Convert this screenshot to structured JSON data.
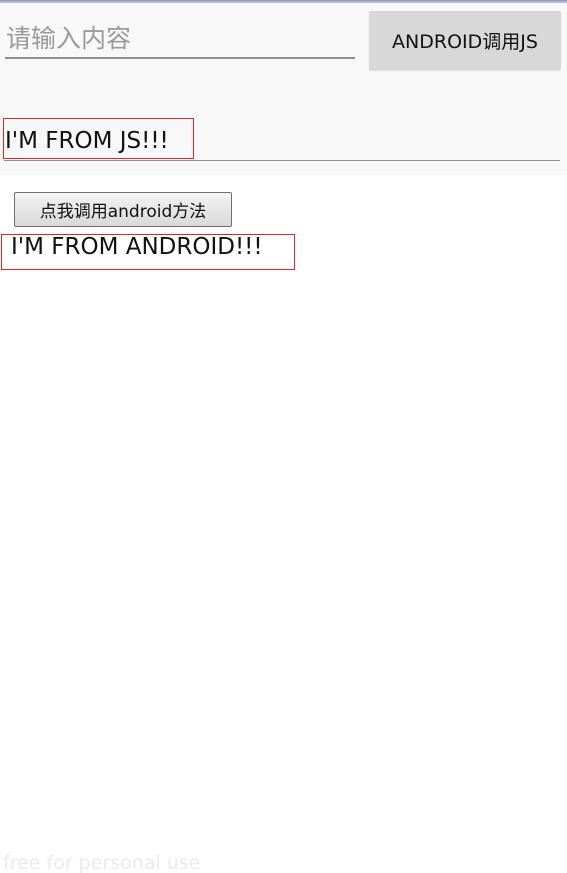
{
  "native": {
    "input_placeholder": "请输入内容",
    "input_value": "",
    "call_js_button_label": "ANDROID调用JS",
    "js_message": "I'M FROM JS!!!"
  },
  "web": {
    "call_android_button_label": "点我调用android方法",
    "android_message": "I'M FROM ANDROID!!!"
  },
  "watermark": "free for personal use",
  "colors": {
    "highlight_border": "#e0242c",
    "native_background": "#f8f8f8",
    "native_button_background": "#d8d8d8",
    "underline": "#8f8f8f"
  }
}
